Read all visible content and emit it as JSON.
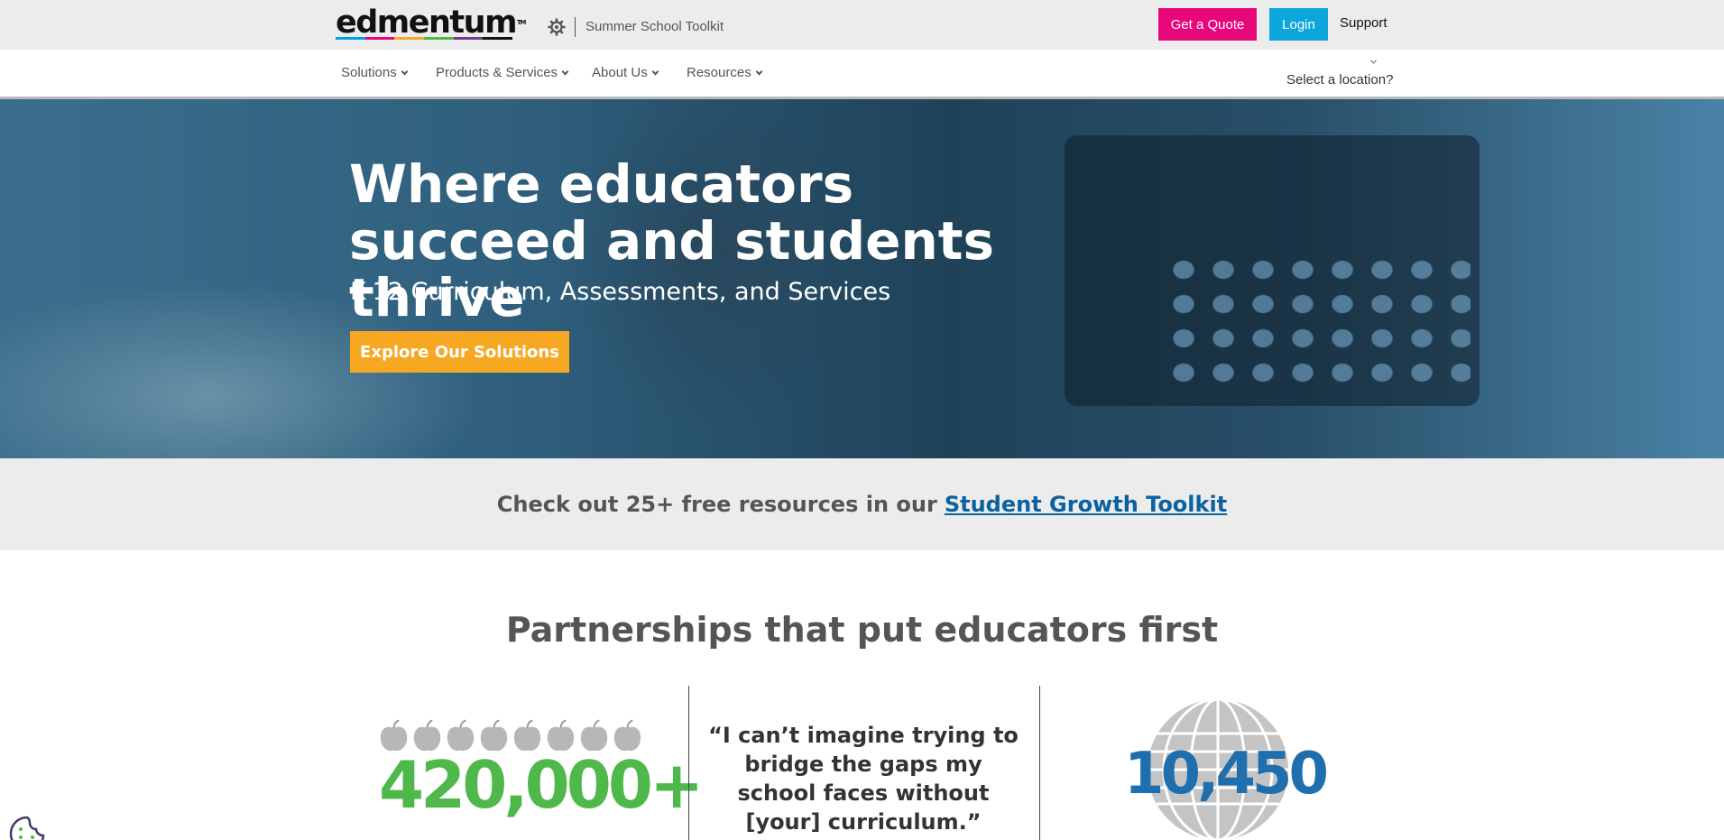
{
  "header": {
    "logo_text": "edmentum",
    "logo_colors": [
      "#00a3e0",
      "#e8077b",
      "#f7a823",
      "#4eb84a",
      "#6d3e91",
      "#111111"
    ],
    "gear_icon": "gear-icon",
    "toolkit_link": "Summer School Toolkit",
    "quote_button": "Get a Quote",
    "login_button": "Login",
    "support_link": "Support"
  },
  "nav": {
    "items": [
      {
        "label": "Solutions"
      },
      {
        "label": "Products & Services"
      },
      {
        "label": "About Us"
      },
      {
        "label": "Resources"
      }
    ],
    "location_label": "Select a location?"
  },
  "hero": {
    "title": "Where educators succeed and students thrive",
    "subtitle": "K-12 Curriculum, Assessments, and Services",
    "cta": "Explore Our Solutions"
  },
  "banner": {
    "text": "Check out 25+ free resources in our",
    "link": "Student Growth Toolkit"
  },
  "partnerships": {
    "title": "Partnerships that put educators first",
    "stat_left": "420,000+",
    "quote": "“I can’t imagine trying to bridge the gaps my school faces without [your] curriculum.”",
    "stat_right": "10,450"
  },
  "colors": {
    "pink": "#e8077b",
    "blue": "#0ca6dc",
    "orange": "#f7a823",
    "green": "#4eb84a",
    "link_blue": "#0a62a0"
  }
}
